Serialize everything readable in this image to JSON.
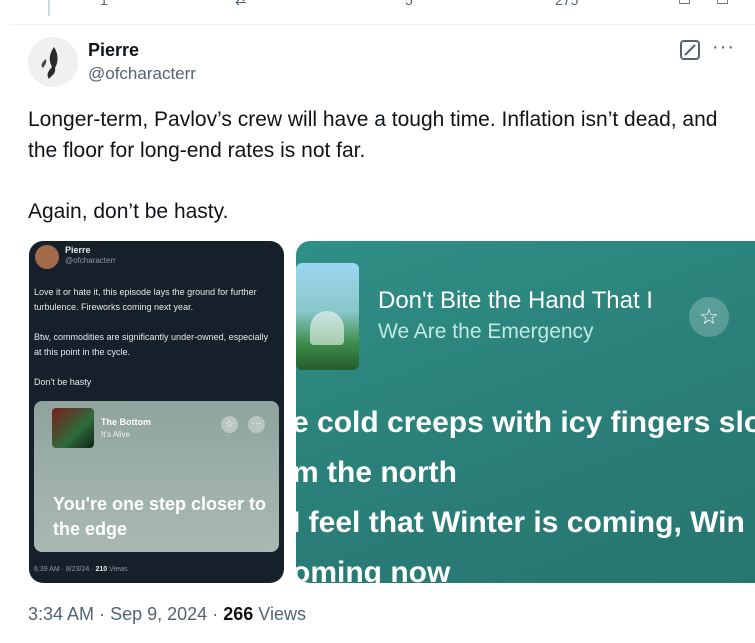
{
  "previous_tweet": {
    "reply_count": "1",
    "like_count": "5",
    "views_count": "275"
  },
  "tweet": {
    "author_name": "Pierre",
    "author_handle": "@ofcharacterr",
    "paragraph1": "Longer-term, Pavlov’s crew will have a tough time. Inflation isn’t dead, and the floor for long-end rates is not far.",
    "paragraph2": "Again, don’t be hasty.",
    "time": "3:34 AM",
    "date": "Sep 9, 2024",
    "views": "266",
    "views_label": "Views",
    "separator": "·"
  },
  "embedded_tweet": {
    "author_name": "Pierre",
    "author_handle": "@ofcharacterr",
    "paragraph1": "Love it or hate it, this episode lays the ground for further turbulence. Fireworks coming next year.",
    "paragraph2": "Btw, commodities are significantly under-owned, especially at this point in the cycle.",
    "paragraph3": "Don't be hasty",
    "song_title": "The Bottom",
    "song_artist": "It's Alive",
    "lyric": "You're one step closer to the edge",
    "meta_time": "6:39 AM · 8/23/24 ·",
    "meta_views": "210",
    "meta_views_label": "Views"
  },
  "music_card": {
    "song_title": "Don't Bite the Hand That I",
    "artist": "We Are the Emergency",
    "lyric_line1": "e cold creeps with icy fingers slo",
    "lyric_line2": "m the north",
    "lyric_line3": "I feel that Winter is coming, Win",
    "lyric_line4": "oming now"
  },
  "icons": {
    "more": "more-icon",
    "grok": "grok-icon",
    "star": "star-icon"
  }
}
